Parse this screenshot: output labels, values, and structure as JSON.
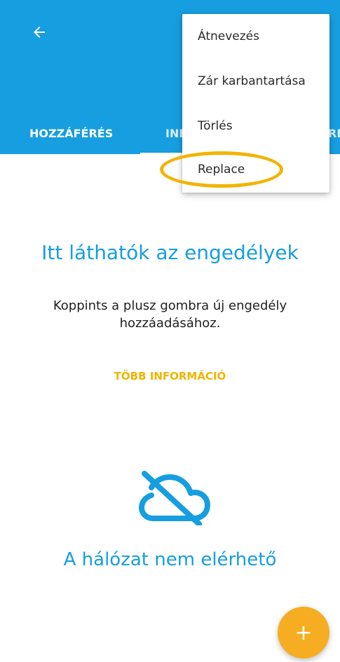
{
  "header": {
    "back_icon": "arrow-left-icon"
  },
  "tabs": [
    {
      "label": "HOZZÁFÉRÉS"
    },
    {
      "label": "INF"
    },
    {
      "label": "RE"
    }
  ],
  "overflow_menu": {
    "items": [
      {
        "label": "Átnevezés"
      },
      {
        "label": "Zár karbantartása"
      },
      {
        "label": "Törlés"
      },
      {
        "label": "Replace"
      }
    ],
    "highlight_color": "#f1b400"
  },
  "empty_state": {
    "title": "Itt láthatók az engedélyek",
    "description": "Koppints a plusz gombra új engedély hozzáadásához.",
    "more_info_label": "TÖBB INFORMÁCIÓ"
  },
  "network": {
    "icon": "cloud-off-icon",
    "message": "A hálózat nem elérhető"
  },
  "fab": {
    "label": "+",
    "icon": "plus-icon"
  },
  "colors": {
    "primary": "#169ee0",
    "accent": "#f1b400",
    "fab": "#f6ad22"
  }
}
